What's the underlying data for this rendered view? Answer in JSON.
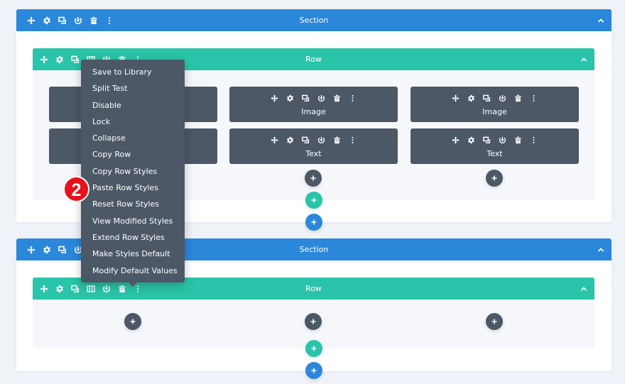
{
  "colors": {
    "section": "#2b87da",
    "row": "#29c4a9",
    "module": "#4c5866",
    "menu": "#4c5866",
    "badge": "#e8101a",
    "background": "#eff2f7"
  },
  "sections": [
    {
      "title": "Section",
      "toolbar_icons": [
        "move-icon",
        "gear-icon",
        "duplicate-icon",
        "power-icon",
        "trash-icon",
        "more-icon"
      ],
      "rows": [
        {
          "title": "Row",
          "toolbar_icons": [
            "move-icon",
            "gear-icon",
            "duplicate-icon",
            "columns-icon",
            "power-icon",
            "trash-icon",
            "more-icon"
          ],
          "columns": [
            {
              "modules": [
                {
                  "title": ""
                },
                {
                  "title": ""
                }
              ]
            },
            {
              "modules": [
                {
                  "title": "Image"
                },
                {
                  "title": "Text"
                }
              ]
            },
            {
              "modules": [
                {
                  "title": "Image"
                },
                {
                  "title": "Text"
                }
              ]
            }
          ]
        }
      ]
    },
    {
      "title": "Section",
      "toolbar_icons": [
        "move-icon",
        "gear-icon",
        "duplicate-icon",
        "power-icon",
        "trash-icon",
        "more-icon"
      ],
      "rows": [
        {
          "title": "Row",
          "toolbar_icons": [
            "move-icon",
            "gear-icon",
            "duplicate-icon",
            "columns-icon",
            "power-icon",
            "trash-icon",
            "more-icon"
          ],
          "columns": [
            {
              "modules": []
            },
            {
              "modules": []
            },
            {
              "modules": []
            }
          ]
        }
      ]
    }
  ],
  "module_toolbar_icons": [
    "move-icon",
    "gear-icon",
    "duplicate-icon",
    "power-icon",
    "trash-icon",
    "more-icon"
  ],
  "context_menu": {
    "items": [
      "Save to Library",
      "Split Test",
      "Disable",
      "Lock",
      "Collapse",
      "Copy Row",
      "Copy Row Styles",
      "Paste Row Styles",
      "Reset Row Styles",
      "View Modified Styles",
      "Extend Row Styles",
      "Make Styles Default",
      "Modify Default Values"
    ]
  },
  "step_badge": "2"
}
